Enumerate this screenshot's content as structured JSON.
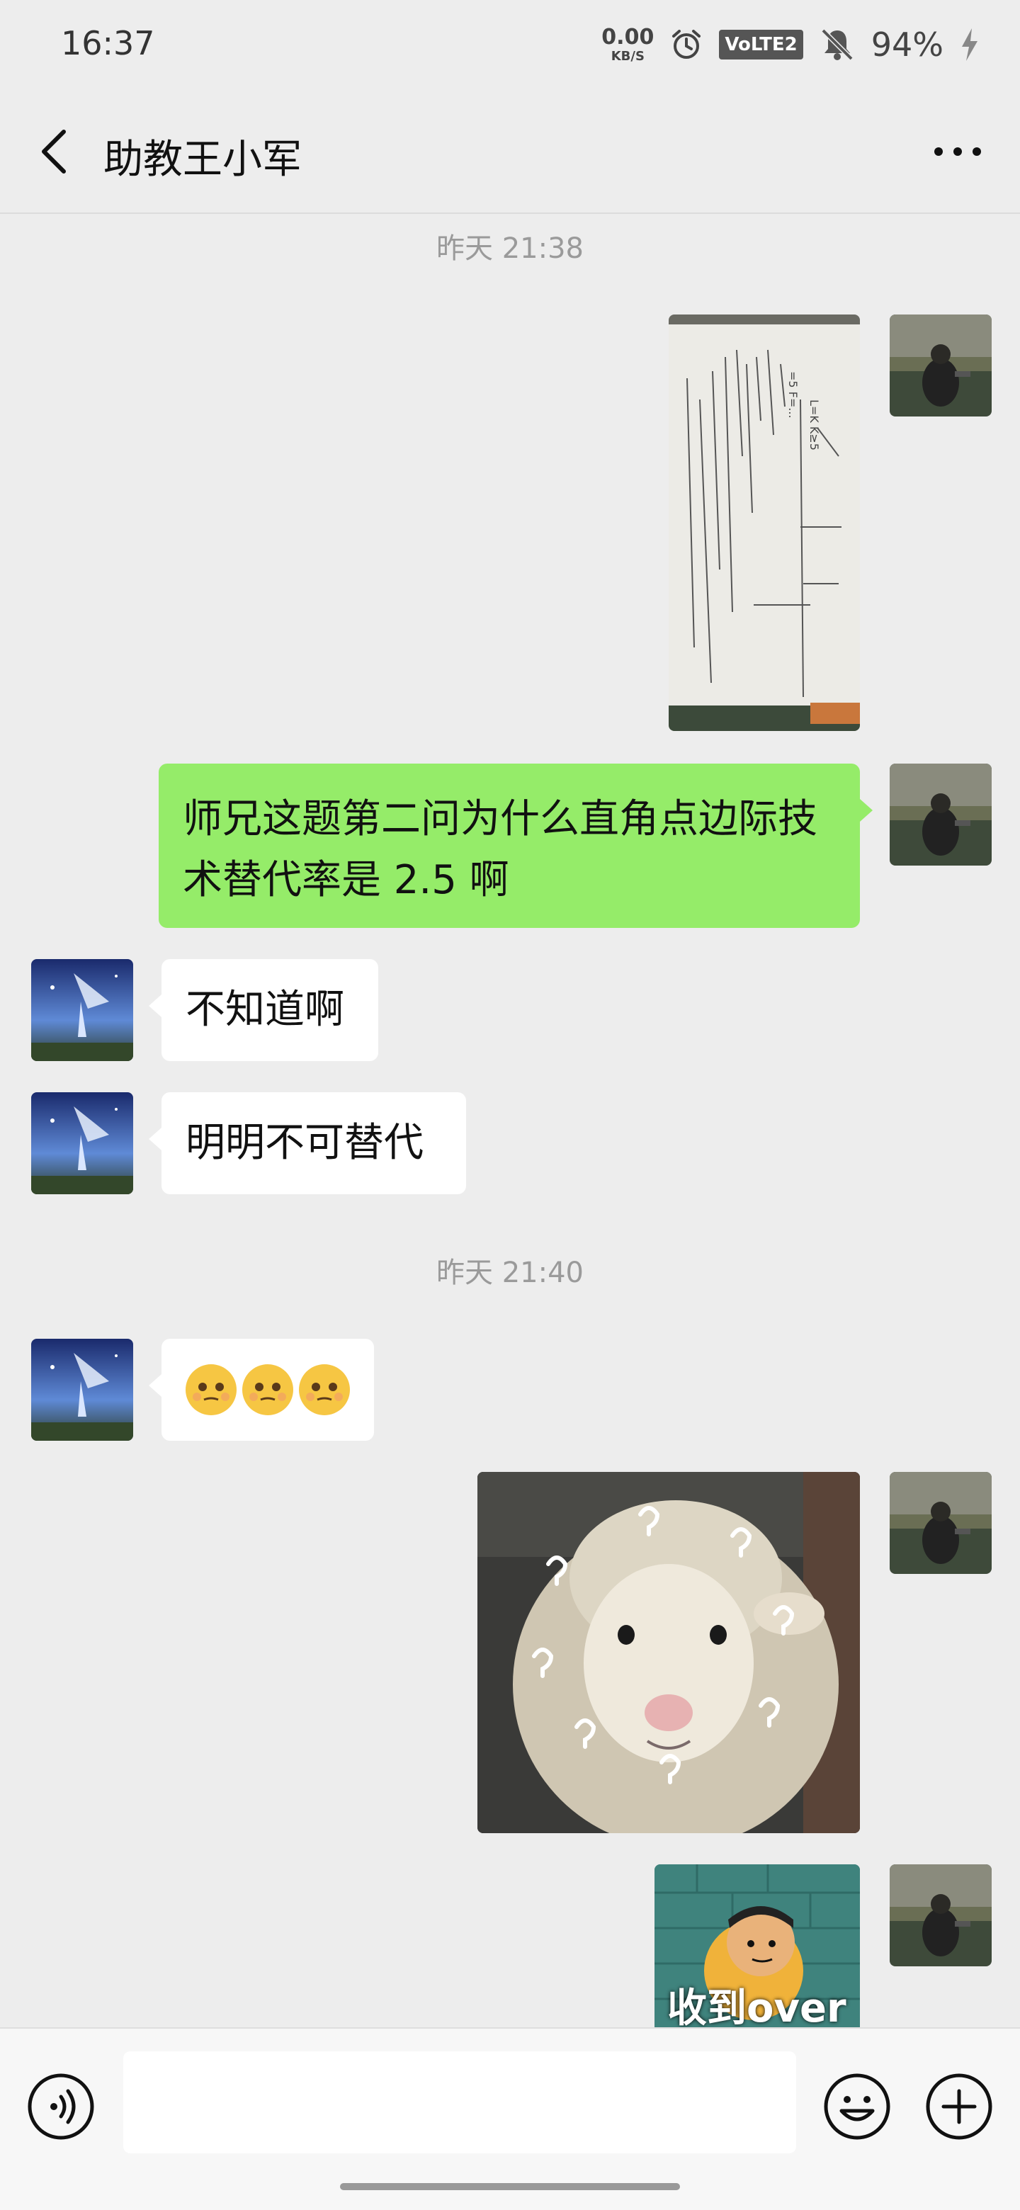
{
  "status_bar": {
    "time": "16:37",
    "net_speed_value": "0.00",
    "net_speed_unit": "KB/S",
    "volte_label": "VoLTE2",
    "battery": "94%"
  },
  "header": {
    "title": "助教王小军",
    "back_icon": "chevron-left-icon",
    "more_icon": "ellipsis-icon"
  },
  "messages": {
    "time1": "昨天 21:38",
    "m2_text": "师兄这题第二问为什么直角点边际技术替代率是 2.5 啊",
    "m3_text": "不知道啊",
    "m4_text": "明明不可替代",
    "time2": "昨天 21:40",
    "m5_text": "🥺🥺🥺",
    "m7_caption": "收到over"
  },
  "input_bar": {
    "placeholder": "",
    "voice_icon": "voice-icon",
    "emoji_icon": "emoji-icon",
    "plus_icon": "plus-icon"
  },
  "colors": {
    "background": "#ededed",
    "sent_bubble": "#95ec69",
    "received_bubble": "#ffffff"
  }
}
